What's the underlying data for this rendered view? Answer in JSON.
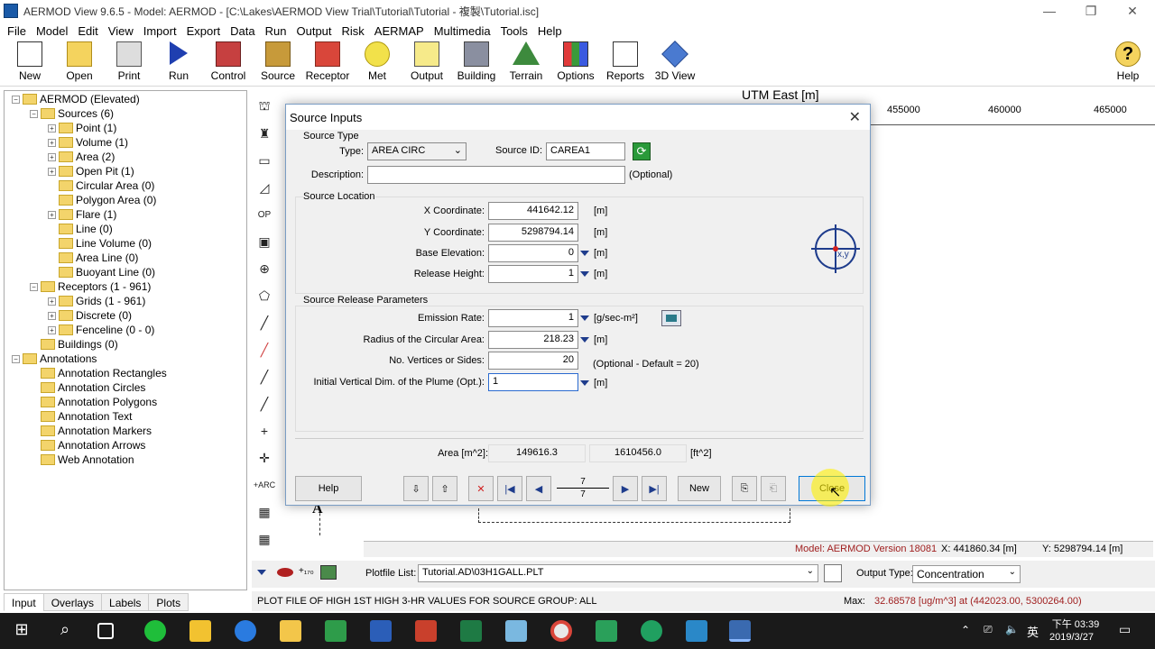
{
  "window": {
    "title": "AERMOD View 9.6.5 - Model: AERMOD  -  [C:\\Lakes\\AERMOD View Trial\\Tutorial\\Tutorial - 複製\\Tutorial.isc]"
  },
  "menu": [
    "File",
    "Model",
    "Edit",
    "View",
    "Import",
    "Export",
    "Data",
    "Run",
    "Output",
    "Risk",
    "AERMAP",
    "Multimedia",
    "Tools",
    "Help"
  ],
  "toolbar": [
    "New",
    "Open",
    "Print",
    "Run",
    "Control",
    "Source",
    "Receptor",
    "Met",
    "Output",
    "Building",
    "Terrain",
    "Options",
    "Reports",
    "3D View",
    "Help"
  ],
  "tree": {
    "root": "AERMOD (Elevated)",
    "sources": "Sources (6)",
    "source_items": [
      "Point (1)",
      "Volume (1)",
      "Area (2)",
      "Open Pit (1)",
      "Circular Area (0)",
      "Polygon Area (0)",
      "Flare (1)",
      "Line (0)",
      "Line Volume (0)",
      "Area Line (0)",
      "Buoyant Line (0)"
    ],
    "receptors": "Receptors (1 - 961)",
    "receptor_items": [
      "Grids (1 - 961)",
      "Discrete (0)",
      "Fenceline (0 - 0)"
    ],
    "buildings": "Buildings (0)",
    "annotations": "Annotations",
    "annotation_items": [
      "Annotation Rectangles",
      "Annotation Circles",
      "Annotation Polygons",
      "Annotation Text",
      "Annotation Markers",
      "Annotation Arrows",
      "Web Annotation"
    ]
  },
  "bottom_tabs": [
    "Input",
    "Overlays",
    "Labels",
    "Plots"
  ],
  "map": {
    "axis_label": "UTM East [m]",
    "ticks": [
      "455000",
      "460000",
      "465000"
    ]
  },
  "status": {
    "model": "Model: AERMOD Version 18081",
    "x": "X: 441860.34 [m]",
    "y": "Y: 5298794.14 [m]"
  },
  "plotfile": {
    "label": "Plotfile List:",
    "value": "Tutorial.AD\\03H1GALL.PLT",
    "output_type_label": "Output Type:",
    "output_type": "Concentration"
  },
  "message": {
    "text": "PLOT FILE OF HIGH 1ST HIGH 3-HR VALUES FOR SOURCE GROUP: ALL",
    "max_label": "Max:",
    "max_value": "32.68578  [ug/m^3]  at  (442023.00, 5300264.00)"
  },
  "taskbar": {
    "time": "下午 03:39",
    "date": "2019/3/27",
    "ime": "英"
  },
  "dialog": {
    "title": "Source Inputs",
    "source_type_group": "Source Type",
    "type_label": "Type:",
    "type_value": "AREA CIRC",
    "source_id_label": "Source ID:",
    "source_id_value": "CAREA1",
    "description_label": "Description:",
    "description_value": "",
    "optional": "(Optional)",
    "location_group": "Source Location",
    "x_label": "X Coordinate:",
    "x_value": "441642.12",
    "y_label": "Y Coordinate:",
    "y_value": "5298794.14",
    "base_label": "Base Elevation:",
    "base_value": "0",
    "release_label": "Release Height:",
    "release_value": "1",
    "unit_m": "[m]",
    "xy_icon_label": "x,y",
    "release_group": "Source Release Parameters",
    "emission_label": "Emission Rate:",
    "emission_value": "1",
    "emission_unit": "[g/sec-m²]",
    "radius_label": "Radius of the Circular Area:",
    "radius_value": "218.23",
    "vertices_label": "No. Vertices or Sides:",
    "vertices_value": "20",
    "vertices_note": "(Optional - Default = 20)",
    "plume_label": "Initial Vertical Dim. of the Plume (Opt.):",
    "plume_value": "1",
    "area_label": "Area [m^2]:",
    "area_m2": "149616.3",
    "area_ft2": "1610456.0",
    "area_ft_unit": "[ft^2]",
    "help_btn": "Help",
    "record_top": "7",
    "record_bottom": "7",
    "new_btn": "New",
    "close_btn": "Close"
  }
}
